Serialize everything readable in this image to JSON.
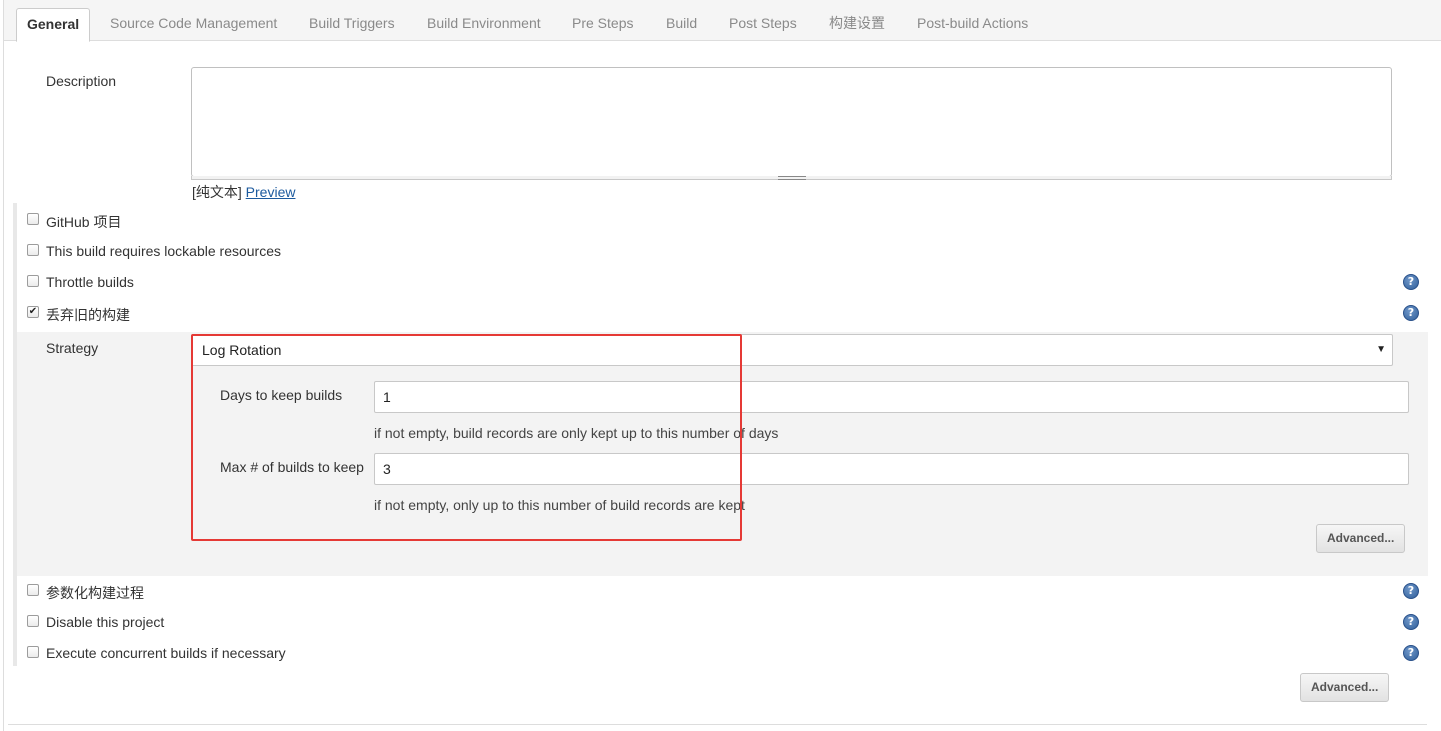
{
  "tabs": [
    {
      "label": "General",
      "active": true
    },
    {
      "label": "Source Code Management"
    },
    {
      "label": "Build Triggers"
    },
    {
      "label": "Build Environment"
    },
    {
      "label": "Pre Steps"
    },
    {
      "label": "Build"
    },
    {
      "label": "Post Steps"
    },
    {
      "label": "构建设置"
    },
    {
      "label": "Post-build Actions"
    }
  ],
  "description": {
    "label": "Description",
    "value": "",
    "markup_prefix": "[纯文本]",
    "preview_link": "Preview"
  },
  "options": [
    {
      "label": "GitHub 项目",
      "checked": false
    },
    {
      "label": "This build requires lockable resources",
      "checked": false
    },
    {
      "label": "Throttle builds",
      "checked": false
    },
    {
      "label": "丢弃旧的构建",
      "checked": true
    }
  ],
  "strategy": {
    "label": "Strategy",
    "selected": "Log Rotation",
    "days_label": "Days to keep builds",
    "days_value": "1",
    "days_hint": "if not empty, build records are only kept up to this number of days",
    "max_label": "Max # of builds to keep",
    "max_value": "3",
    "max_hint": "if not empty, only up to this number of build records are kept",
    "advanced": "Advanced..."
  },
  "options_lower": [
    {
      "label": "参数化构建过程",
      "checked": false
    },
    {
      "label": "Disable this project",
      "checked": false
    },
    {
      "label": "Execute concurrent builds if necessary",
      "checked": false
    }
  ],
  "advanced_button": "Advanced...",
  "icons": {
    "help": "?",
    "checkmark": "✔",
    "dropdown_arrow": "▼"
  },
  "colors": {
    "highlight_border": "#e53935",
    "link": "#1c5a9e",
    "help_icon": "#2f5e9a"
  }
}
